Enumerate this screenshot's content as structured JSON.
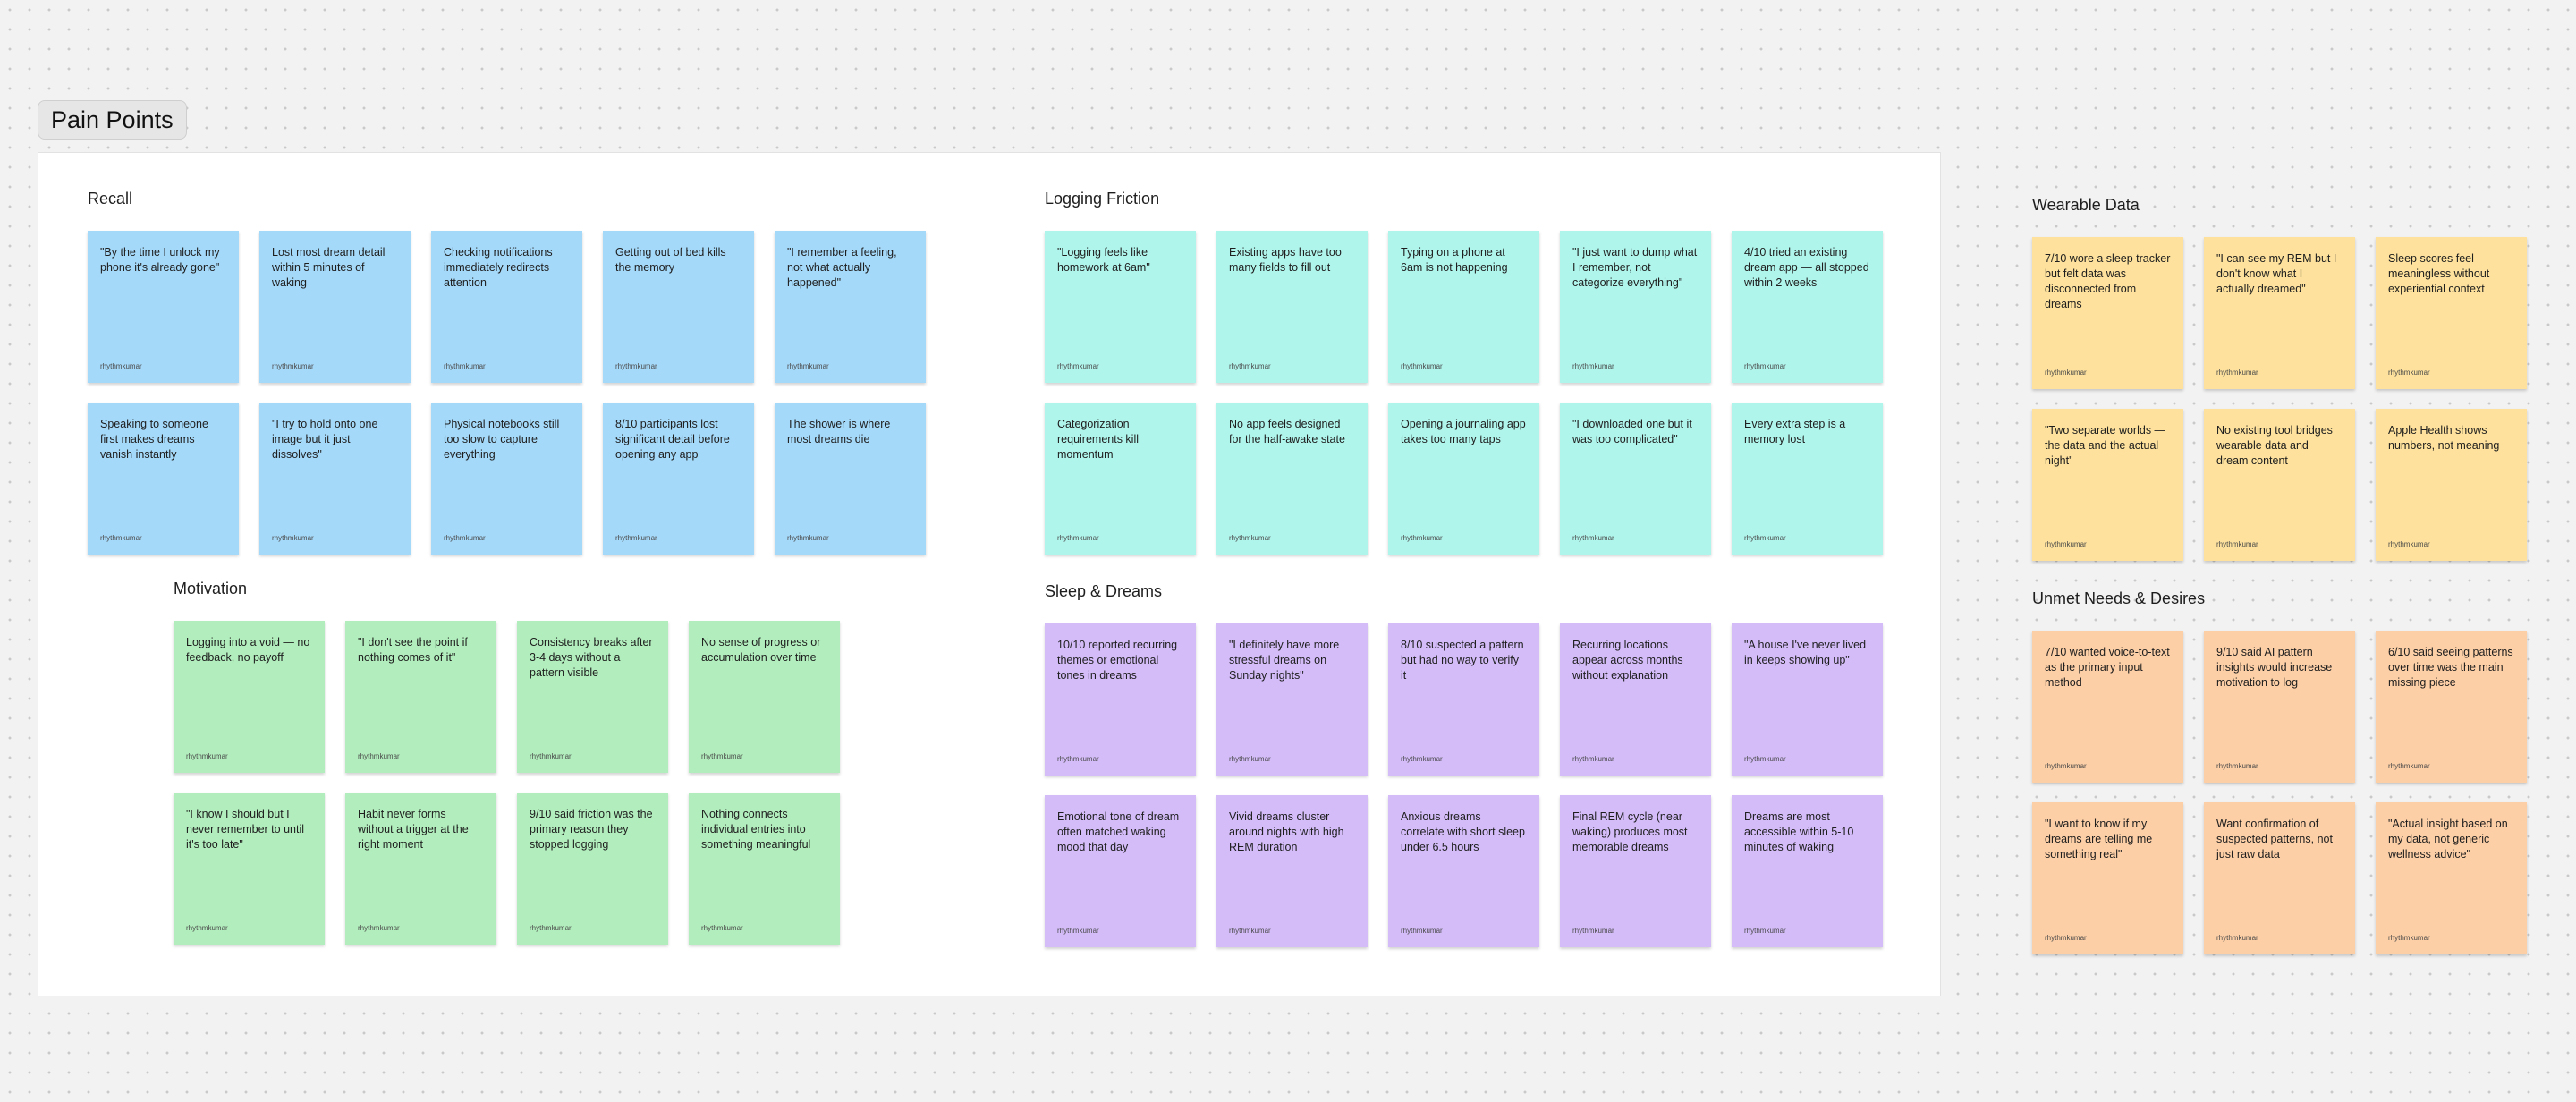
{
  "board": {
    "frame_title": "Pain Points"
  },
  "sections": {
    "recall": {
      "title": "Recall",
      "color": "#a5d9f9",
      "notes": [
        {
          "text": "\"By the time I unlock my phone it's already gone\"",
          "author": "rhythmkumar"
        },
        {
          "text": "Lost most dream detail within 5 minutes of waking",
          "author": "rhythmkumar"
        },
        {
          "text": "Checking notifications immediately redirects attention",
          "author": "rhythmkumar"
        },
        {
          "text": "Getting out of bed kills the memory",
          "author": "rhythmkumar"
        },
        {
          "text": "\"I remember a feeling, not what actually happened\"",
          "author": "rhythmkumar"
        },
        {
          "text": "Speaking to someone first makes dreams vanish instantly",
          "author": "rhythmkumar"
        },
        {
          "text": "\"I try to hold onto one image but it just dissolves\"",
          "author": "rhythmkumar"
        },
        {
          "text": "Physical notebooks still too slow to capture everything",
          "author": "rhythmkumar"
        },
        {
          "text": "8/10 participants lost significant detail before opening any app",
          "author": "rhythmkumar"
        },
        {
          "text": "The shower is where most dreams die",
          "author": "rhythmkumar"
        }
      ]
    },
    "logging_friction": {
      "title": "Logging Friction",
      "color": "#b0f5ec",
      "notes": [
        {
          "text": "\"Logging feels like homework at 6am\"",
          "author": "rhythmkumar"
        },
        {
          "text": "Existing apps have too many fields to fill out",
          "author": "rhythmkumar"
        },
        {
          "text": "Typing on a phone at 6am is not happening",
          "author": "rhythmkumar"
        },
        {
          "text": "\"I just want to dump what I remember, not categorize everything\"",
          "author": "rhythmkumar"
        },
        {
          "text": "4/10 tried an existing dream app — all stopped within 2 weeks",
          "author": "rhythmkumar"
        },
        {
          "text": "Categorization requirements kill momentum",
          "author": "rhythmkumar"
        },
        {
          "text": "No app feels designed for the half-awake state",
          "author": "rhythmkumar"
        },
        {
          "text": "Opening a journaling app takes too many taps",
          "author": "rhythmkumar"
        },
        {
          "text": "\"I downloaded one but it was too complicated\"",
          "author": "rhythmkumar"
        },
        {
          "text": "Every extra step is a memory lost",
          "author": "rhythmkumar"
        }
      ]
    },
    "motivation": {
      "title": "Motivation",
      "color": "#b2eebd",
      "notes": [
        {
          "text": "Logging into a void — no feedback, no payoff",
          "author": "rhythmkumar"
        },
        {
          "text": "\"I don't see the point if nothing comes of it\"",
          "author": "rhythmkumar"
        },
        {
          "text": "Consistency breaks after 3-4 days without a pattern visible",
          "author": "rhythmkumar"
        },
        {
          "text": "No sense of progress or accumulation over time",
          "author": "rhythmkumar"
        },
        {
          "text": "\"I know I should but I never remember to until it's too late\"",
          "author": "rhythmkumar"
        },
        {
          "text": "Habit never forms without a trigger at the right moment",
          "author": "rhythmkumar"
        },
        {
          "text": "9/10 said friction was the primary reason they stopped logging",
          "author": "rhythmkumar"
        },
        {
          "text": "Nothing connects individual entries into something meaningful",
          "author": "rhythmkumar"
        }
      ]
    },
    "sleep_dreams": {
      "title": "Sleep & Dreams",
      "color": "#d4bcf9",
      "notes": [
        {
          "text": "10/10 reported recurring themes or emotional tones in dreams",
          "author": "rhythmkumar"
        },
        {
          "text": "\"I definitely have more stressful dreams on Sunday nights\"",
          "author": "rhythmkumar"
        },
        {
          "text": "8/10 suspected a pattern but had no way to verify it",
          "author": "rhythmkumar"
        },
        {
          "text": "Recurring locations appear across months without explanation",
          "author": "rhythmkumar"
        },
        {
          "text": "\"A house I've never lived in keeps showing up\"",
          "author": "rhythmkumar"
        },
        {
          "text": "Emotional tone of dream often matched waking mood that day",
          "author": "rhythmkumar"
        },
        {
          "text": "Vivid dreams cluster around nights with high REM duration",
          "author": "rhythmkumar"
        },
        {
          "text": "Anxious dreams correlate with short sleep under 6.5 hours",
          "author": "rhythmkumar"
        },
        {
          "text": "Final REM cycle (near waking) produces most memorable dreams",
          "author": "rhythmkumar"
        },
        {
          "text": "Dreams are most accessible within 5-10 minutes of waking",
          "author": "rhythmkumar"
        }
      ]
    },
    "wearable_data": {
      "title": "Wearable Data",
      "color": "#fde19c",
      "notes": [
        {
          "text": "7/10 wore a sleep tracker but felt data was disconnected from dreams",
          "author": "rhythmkumar"
        },
        {
          "text": "\"I can see my REM but I don't know what I actually dreamed\"",
          "author": "rhythmkumar"
        },
        {
          "text": "Sleep scores feel meaningless without experiential context",
          "author": "rhythmkumar"
        },
        {
          "text": "\"Two separate worlds — the data and the actual night\"",
          "author": "rhythmkumar"
        },
        {
          "text": "No existing tool bridges wearable data and dream content",
          "author": "rhythmkumar"
        },
        {
          "text": "Apple Health shows numbers, not meaning",
          "author": "rhythmkumar"
        }
      ]
    },
    "unmet_needs": {
      "title": "Unmet Needs & Desires",
      "color": "#fdcfa6",
      "notes": [
        {
          "text": "7/10 wanted voice-to-text as the primary input method",
          "author": "rhythmkumar"
        },
        {
          "text": "9/10 said AI pattern insights would increase motivation to log",
          "author": "rhythmkumar"
        },
        {
          "text": "6/10 said seeing patterns over time was the main missing piece",
          "author": "rhythmkumar"
        },
        {
          "text": "\"I want to know if my dreams are telling me something real\"",
          "author": "rhythmkumar"
        },
        {
          "text": "Want confirmation of suspected patterns, not just raw data",
          "author": "rhythmkumar"
        },
        {
          "text": "\"Actual insight based on my data, not generic wellness advice\"",
          "author": "rhythmkumar"
        }
      ]
    }
  }
}
